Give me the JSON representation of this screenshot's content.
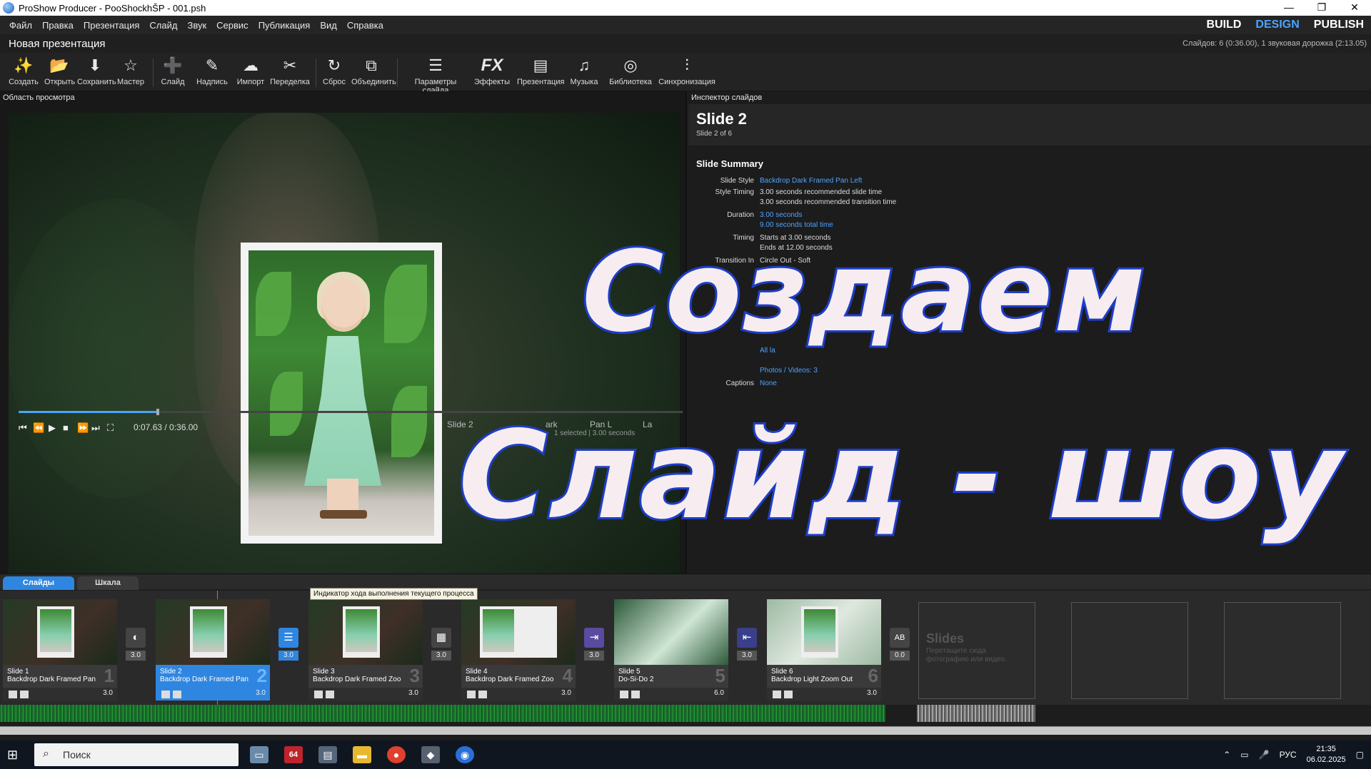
{
  "window": {
    "title": "ProShow Producer - PooShockhŠР - 001.psh",
    "controls": [
      "—",
      "❐",
      "✕"
    ]
  },
  "menu": [
    "Файл",
    "Правка",
    "Презентация",
    "Слайд",
    "Звук",
    "Сервис",
    "Публикация",
    "Вид",
    "Справка"
  ],
  "modes": {
    "build": "BUILD",
    "design": "DESIGN",
    "publish": "PUBLISH"
  },
  "show": {
    "title": "Новая презентация",
    "status": "Слайдов: 6 (0:36.00), 1 звуковая дорожка (2:13.05)"
  },
  "toolbar": [
    {
      "label": "Создать",
      "icon": "create-icon",
      "glyph": "✨"
    },
    {
      "label": "Открыть",
      "icon": "open-folder-icon",
      "glyph": "📂"
    },
    {
      "label": "Сохранить",
      "icon": "save-icon",
      "glyph": "⬇"
    },
    {
      "label": "Мастер",
      "icon": "wizard-icon",
      "glyph": "☆"
    },
    {
      "label": "Слайд",
      "icon": "add-slide-icon",
      "glyph": "➕"
    },
    {
      "label": "Надпись",
      "icon": "caption-icon",
      "glyph": "✎"
    },
    {
      "label": "Импорт",
      "icon": "import-icon",
      "glyph": "☁"
    },
    {
      "label": "Переделка",
      "icon": "remix-icon",
      "glyph": "✂"
    },
    {
      "label": "Сброс",
      "icon": "reset-icon",
      "glyph": "↻"
    },
    {
      "label": "Объединить",
      "icon": "merge-icon",
      "glyph": "⧉"
    },
    {
      "label": "Параметры слайда",
      "icon": "slide-options-icon",
      "glyph": "☰"
    },
    {
      "label": "Эффекты",
      "icon": "fx-icon",
      "glyph": "FX"
    },
    {
      "label": "Презентация",
      "icon": "presentation-icon",
      "glyph": "▤"
    },
    {
      "label": "Музыка",
      "icon": "music-icon",
      "glyph": "♫"
    },
    {
      "label": "Библиотека",
      "icon": "library-icon",
      "glyph": "◎"
    },
    {
      "label": "Синхронизация",
      "icon": "sync-icon",
      "glyph": "⫶"
    }
  ],
  "preview": {
    "label": "Область просмотра",
    "timecode": "0:07.63 / 0:36.00",
    "info_partial": "Slide 2",
    "info_partial2": "ark",
    "info_partial3": "Pan L",
    "info_partial4": "La",
    "info_sub": "1 selected  |  3.00 seconds",
    "progress": 0.21
  },
  "inspector": {
    "label": "Инспектор слайдов",
    "title": "Slide 2",
    "subtitle": "Slide 2 of 6",
    "summary_title": "Slide Summary",
    "rows": [
      {
        "k": "Slide Style",
        "v": "Backdrop Dark Framed Pan Left",
        "link": true
      },
      {
        "k": "Style Timing",
        "v": "3.00 seconds recommended slide time"
      },
      {
        "k": "",
        "v": "3.00 seconds recommended transition time"
      },
      {
        "k": "Duration",
        "v": "3.00 seconds",
        "link": true
      },
      {
        "k": "",
        "v": "9.00 seconds total time",
        "link": true
      },
      {
        "k": "Timing",
        "v": "Starts at 3.00 seconds"
      },
      {
        "k": "",
        "v": "Ends at 12.00 seconds"
      },
      {
        "k": "Transition In",
        "v": "Circle Out - Soft"
      },
      {
        "k": "",
        "v": "3.00 seco"
      }
    ],
    "layers_title": "ers an",
    "layers_link": "All la",
    "photos": "Photos / Videos: 3",
    "captions_k": "Captions",
    "captions_v": "None"
  },
  "overlay": {
    "line1": "Создаем",
    "line2": "Слайд - шоу"
  },
  "bottom": {
    "tabs": {
      "slides": "Слайды",
      "timeline": "Шкала"
    },
    "tooltip": "Индикатор хода выполнения текущего процесса",
    "slides": [
      {
        "name": "Slide 1",
        "style": "Backdrop Dark Framed Pan...",
        "num": "1",
        "dur": "3.0"
      },
      {
        "name": "Slide 2",
        "style": "Backdrop Dark Framed Pan...",
        "num": "2",
        "dur": "3.0"
      },
      {
        "name": "Slide 3",
        "style": "Backdrop Dark Framed Zoo...",
        "num": "3",
        "dur": "3.0"
      },
      {
        "name": "Slide 4",
        "style": "Backdrop Dark Framed Zoo...",
        "num": "4",
        "dur": "3.0"
      },
      {
        "name": "Slide 5",
        "style": "Do-Si-Do 2",
        "num": "5",
        "dur": "6.0"
      },
      {
        "name": "Slide 6",
        "style": "Backdrop Light Zoom Out",
        "num": "6",
        "dur": "3.0"
      }
    ],
    "transitions": [
      {
        "dur": "3.0",
        "icon": "circle-transition-icon",
        "glyph": "◐"
      },
      {
        "dur": "3.0",
        "icon": "lines-transition-icon",
        "glyph": "☰"
      },
      {
        "dur": "3.0",
        "icon": "blinds-transition-icon",
        "glyph": "▦"
      },
      {
        "dur": "3.0",
        "icon": "push-transition-icon",
        "glyph": "⇥"
      },
      {
        "dur": "3.0",
        "icon": "slide-transition-icon",
        "glyph": "⇤"
      },
      {
        "dur": "0.0",
        "icon": "ab-transition-icon",
        "glyph": "AB"
      }
    ],
    "empty": {
      "title": "Slides",
      "hint": "Перетащите сюда фотографию или видео."
    }
  },
  "taskbar": {
    "search": "Поиск",
    "lang": "РУС",
    "time": "21:35",
    "date": "06.02.2025"
  }
}
